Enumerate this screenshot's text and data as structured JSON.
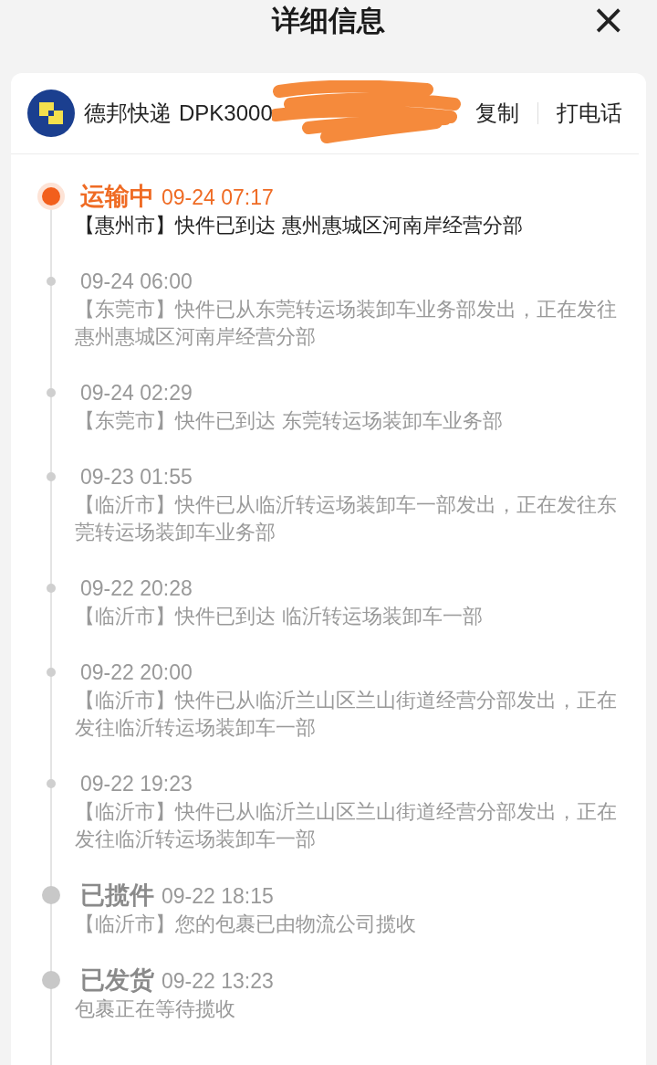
{
  "header": {
    "title": "详细信息",
    "close": "×"
  },
  "carrier": {
    "name": "德邦快递",
    "tracking": "DPK3000",
    "redacted": true,
    "actions": [
      "复制",
      "打电话"
    ]
  },
  "events": [
    {
      "kind": "status",
      "current": true,
      "status": "运输中",
      "time": "09-24 07:17",
      "text": "【惠州市】快件已到达 惠州惠城区河南岸经营分部"
    },
    {
      "kind": "plain",
      "current": false,
      "time": "09-24 06:00",
      "text": "【东莞市】快件已从东莞转运场装卸车业务部发出，正在发往惠州惠城区河南岸经营分部"
    },
    {
      "kind": "plain",
      "current": false,
      "time": "09-24 02:29",
      "text": "【东莞市】快件已到达 东莞转运场装卸车业务部"
    },
    {
      "kind": "plain",
      "current": false,
      "time": "09-23 01:55",
      "text": "【临沂市】快件已从临沂转运场装卸车一部发出，正在发往东莞转运场装卸车业务部"
    },
    {
      "kind": "plain",
      "current": false,
      "time": "09-22 20:28",
      "text": "【临沂市】快件已到达 临沂转运场装卸车一部"
    },
    {
      "kind": "plain",
      "current": false,
      "time": "09-22 20:00",
      "text": "【临沂市】快件已从临沂兰山区兰山街道经营分部发出，正在发往临沂转运场装卸车一部"
    },
    {
      "kind": "plain",
      "current": false,
      "time": "09-22 19:23",
      "text": "【临沂市】快件已从临沂兰山区兰山街道经营分部发出，正在发往临沂转运场装卸车一部"
    },
    {
      "kind": "status",
      "current": false,
      "status": "已揽件",
      "time": "09-22 18:15",
      "text": "【临沂市】您的包裹已由物流公司揽收"
    },
    {
      "kind": "status",
      "current": false,
      "status": "已发货",
      "time": "09-22 13:23",
      "text": "包裹正在等待揽收"
    }
  ]
}
